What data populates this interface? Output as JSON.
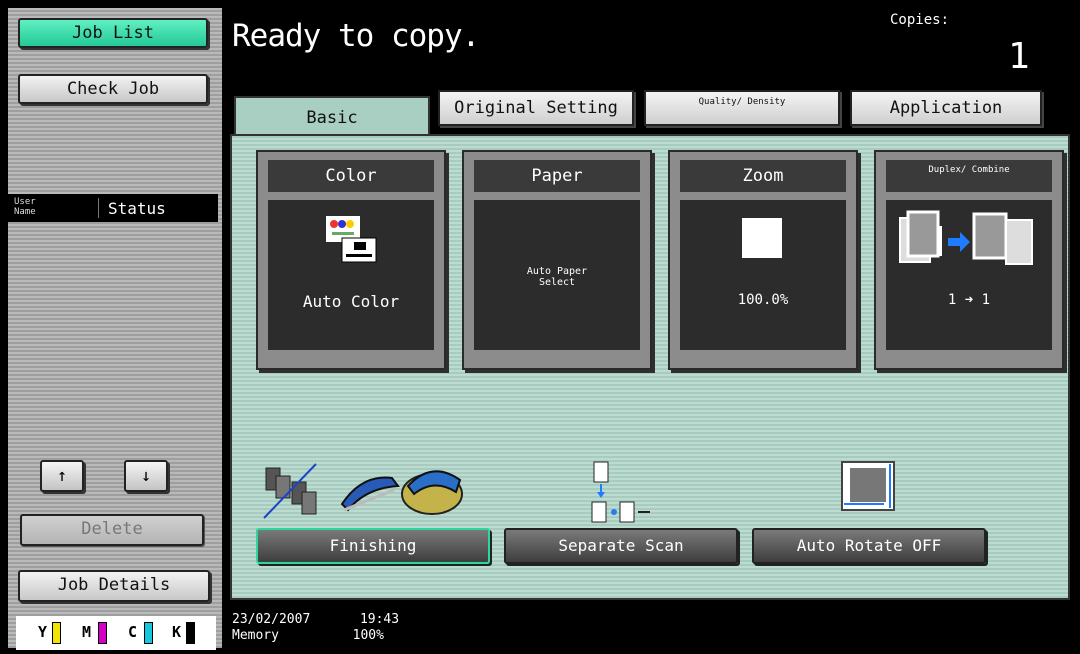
{
  "sidebar": {
    "job_list_label": "Job List",
    "check_job_label": "Check Job",
    "header_user": "User Name",
    "header_status": "Status",
    "up_glyph": "↑",
    "down_glyph": "↓",
    "delete_label": "Delete",
    "job_details_label": "Job Details",
    "toner": [
      {
        "letter": "Y",
        "color": "#f2e400"
      },
      {
        "letter": "M",
        "color": "#d400c8"
      },
      {
        "letter": "C",
        "color": "#14c8e0"
      },
      {
        "letter": "K",
        "color": "#000000"
      }
    ]
  },
  "status": {
    "message": "Ready to copy.",
    "copies_label": "Copies:",
    "copies_value": "1"
  },
  "tabs": {
    "basic": "Basic",
    "original_setting": "Original Setting",
    "quality_density": "Quality/ Density",
    "application": "Application"
  },
  "functions": {
    "color": {
      "title": "Color",
      "value": "Auto Color"
    },
    "paper": {
      "title": "Paper",
      "value": "Auto Paper Select"
    },
    "zoom": {
      "title": "Zoom",
      "value": "100.0%"
    },
    "duplex": {
      "title": "Duplex/ Combine",
      "value": "1 ➜ 1"
    }
  },
  "bottom_buttons": {
    "finishing": "Finishing",
    "separate_scan": "Separate Scan",
    "auto_rotate": "Auto Rotate OFF"
  },
  "footer": {
    "date": "23/02/2007",
    "time": "19:43",
    "memory_label": "Memory",
    "memory_value": "100%"
  },
  "accent": {
    "active_green": "#2bd79e",
    "panel_teal": "#a7cbbf"
  }
}
